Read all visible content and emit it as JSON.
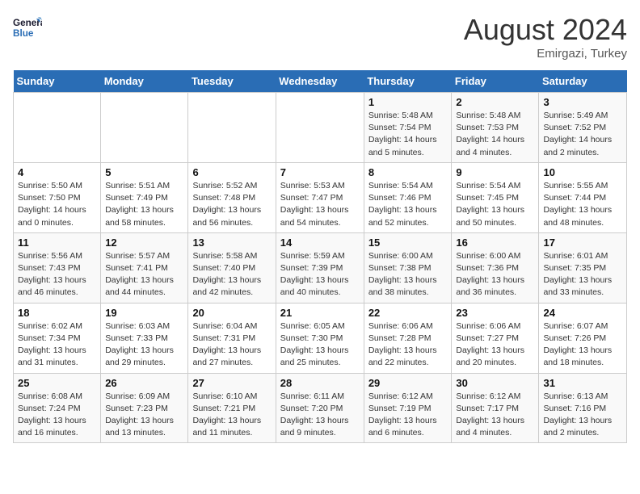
{
  "header": {
    "logo_general": "General",
    "logo_blue": "Blue",
    "month_title": "August 2024",
    "location": "Emirgazi, Turkey"
  },
  "weekdays": [
    "Sunday",
    "Monday",
    "Tuesday",
    "Wednesday",
    "Thursday",
    "Friday",
    "Saturday"
  ],
  "weeks": [
    [
      {
        "day": "",
        "info": ""
      },
      {
        "day": "",
        "info": ""
      },
      {
        "day": "",
        "info": ""
      },
      {
        "day": "",
        "info": ""
      },
      {
        "day": "1",
        "info": "Sunrise: 5:48 AM\nSunset: 7:54 PM\nDaylight: 14 hours\nand 5 minutes."
      },
      {
        "day": "2",
        "info": "Sunrise: 5:48 AM\nSunset: 7:53 PM\nDaylight: 14 hours\nand 4 minutes."
      },
      {
        "day": "3",
        "info": "Sunrise: 5:49 AM\nSunset: 7:52 PM\nDaylight: 14 hours\nand 2 minutes."
      }
    ],
    [
      {
        "day": "4",
        "info": "Sunrise: 5:50 AM\nSunset: 7:50 PM\nDaylight: 14 hours\nand 0 minutes."
      },
      {
        "day": "5",
        "info": "Sunrise: 5:51 AM\nSunset: 7:49 PM\nDaylight: 13 hours\nand 58 minutes."
      },
      {
        "day": "6",
        "info": "Sunrise: 5:52 AM\nSunset: 7:48 PM\nDaylight: 13 hours\nand 56 minutes."
      },
      {
        "day": "7",
        "info": "Sunrise: 5:53 AM\nSunset: 7:47 PM\nDaylight: 13 hours\nand 54 minutes."
      },
      {
        "day": "8",
        "info": "Sunrise: 5:54 AM\nSunset: 7:46 PM\nDaylight: 13 hours\nand 52 minutes."
      },
      {
        "day": "9",
        "info": "Sunrise: 5:54 AM\nSunset: 7:45 PM\nDaylight: 13 hours\nand 50 minutes."
      },
      {
        "day": "10",
        "info": "Sunrise: 5:55 AM\nSunset: 7:44 PM\nDaylight: 13 hours\nand 48 minutes."
      }
    ],
    [
      {
        "day": "11",
        "info": "Sunrise: 5:56 AM\nSunset: 7:43 PM\nDaylight: 13 hours\nand 46 minutes."
      },
      {
        "day": "12",
        "info": "Sunrise: 5:57 AM\nSunset: 7:41 PM\nDaylight: 13 hours\nand 44 minutes."
      },
      {
        "day": "13",
        "info": "Sunrise: 5:58 AM\nSunset: 7:40 PM\nDaylight: 13 hours\nand 42 minutes."
      },
      {
        "day": "14",
        "info": "Sunrise: 5:59 AM\nSunset: 7:39 PM\nDaylight: 13 hours\nand 40 minutes."
      },
      {
        "day": "15",
        "info": "Sunrise: 6:00 AM\nSunset: 7:38 PM\nDaylight: 13 hours\nand 38 minutes."
      },
      {
        "day": "16",
        "info": "Sunrise: 6:00 AM\nSunset: 7:36 PM\nDaylight: 13 hours\nand 36 minutes."
      },
      {
        "day": "17",
        "info": "Sunrise: 6:01 AM\nSunset: 7:35 PM\nDaylight: 13 hours\nand 33 minutes."
      }
    ],
    [
      {
        "day": "18",
        "info": "Sunrise: 6:02 AM\nSunset: 7:34 PM\nDaylight: 13 hours\nand 31 minutes."
      },
      {
        "day": "19",
        "info": "Sunrise: 6:03 AM\nSunset: 7:33 PM\nDaylight: 13 hours\nand 29 minutes."
      },
      {
        "day": "20",
        "info": "Sunrise: 6:04 AM\nSunset: 7:31 PM\nDaylight: 13 hours\nand 27 minutes."
      },
      {
        "day": "21",
        "info": "Sunrise: 6:05 AM\nSunset: 7:30 PM\nDaylight: 13 hours\nand 25 minutes."
      },
      {
        "day": "22",
        "info": "Sunrise: 6:06 AM\nSunset: 7:28 PM\nDaylight: 13 hours\nand 22 minutes."
      },
      {
        "day": "23",
        "info": "Sunrise: 6:06 AM\nSunset: 7:27 PM\nDaylight: 13 hours\nand 20 minutes."
      },
      {
        "day": "24",
        "info": "Sunrise: 6:07 AM\nSunset: 7:26 PM\nDaylight: 13 hours\nand 18 minutes."
      }
    ],
    [
      {
        "day": "25",
        "info": "Sunrise: 6:08 AM\nSunset: 7:24 PM\nDaylight: 13 hours\nand 16 minutes."
      },
      {
        "day": "26",
        "info": "Sunrise: 6:09 AM\nSunset: 7:23 PM\nDaylight: 13 hours\nand 13 minutes."
      },
      {
        "day": "27",
        "info": "Sunrise: 6:10 AM\nSunset: 7:21 PM\nDaylight: 13 hours\nand 11 minutes."
      },
      {
        "day": "28",
        "info": "Sunrise: 6:11 AM\nSunset: 7:20 PM\nDaylight: 13 hours\nand 9 minutes."
      },
      {
        "day": "29",
        "info": "Sunrise: 6:12 AM\nSunset: 7:19 PM\nDaylight: 13 hours\nand 6 minutes."
      },
      {
        "day": "30",
        "info": "Sunrise: 6:12 AM\nSunset: 7:17 PM\nDaylight: 13 hours\nand 4 minutes."
      },
      {
        "day": "31",
        "info": "Sunrise: 6:13 AM\nSunset: 7:16 PM\nDaylight: 13 hours\nand 2 minutes."
      }
    ]
  ]
}
